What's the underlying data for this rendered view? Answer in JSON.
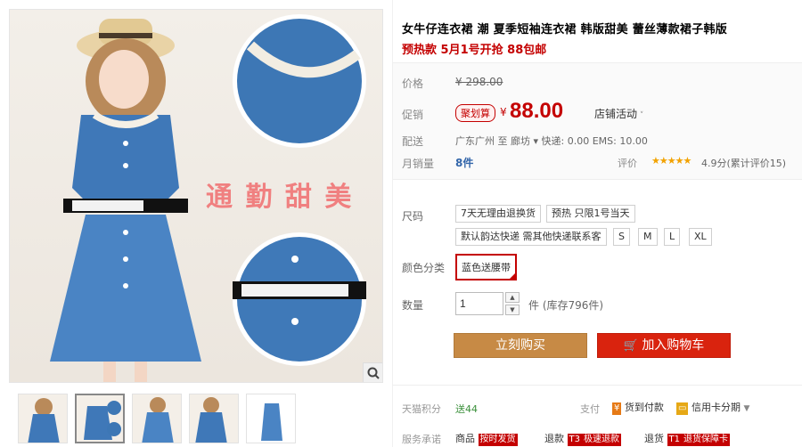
{
  "gallery": {
    "overlay_text": "通 勤 甜 美",
    "thumb_count": 5
  },
  "product": {
    "title": "女牛仔连衣裙 潮 夏季短袖连衣裙 韩版甜美 蕾丝薄款裙子韩版",
    "subtitle": "预热款 5月1号开抢 88包邮"
  },
  "price": {
    "price_label": "价格",
    "original_price": "¥ 298.00",
    "promo_label": "促销",
    "promo_badge": "聚划算",
    "yen": "¥",
    "current_price": "88.00",
    "shop_promo": "店铺活动",
    "shipping_label": "配送",
    "shipping_text": "广东广州  至  廊坊 ▾  快递: 0.00 EMS: 10.00",
    "sales_label": "月销量",
    "sales_value": "8件",
    "review_label": "评价",
    "stars": "★★★★★",
    "review_score": "4.9分(累计评价15)"
  },
  "sku": {
    "size_label": "尺码",
    "size_options": [
      "7天无理由退换货",
      "预热 只限1号当天",
      "默认韵达快递 需其他快递联系客",
      "S",
      "M",
      "L",
      "XL"
    ],
    "color_label": "颜色分类",
    "color_selected": "蓝色送腰带",
    "qty_label": "数量",
    "qty_value": "1",
    "stock_text": "件 (库存796件)"
  },
  "actions": {
    "buy_now": "立刻购买",
    "add_to_cart": "加入购物车"
  },
  "footer": {
    "points_label": "天猫积分",
    "points_value": "送44",
    "pay_label": "支付",
    "cod": "货到付款",
    "credit": "信用卡分期",
    "service_label": "服务承诺",
    "goods": "商品",
    "on_time": "按时发货",
    "refund": "退款",
    "refund_badge": "T3",
    "fast_refund": "极速退款",
    "return": "退货",
    "return_badge": "T1",
    "return_guarantee": "退货保障卡"
  },
  "colors": {
    "accent_red": "#c40000",
    "buy_button": "#c78a45",
    "cart_button": "#d9230e",
    "denim": "#3f78b8"
  }
}
